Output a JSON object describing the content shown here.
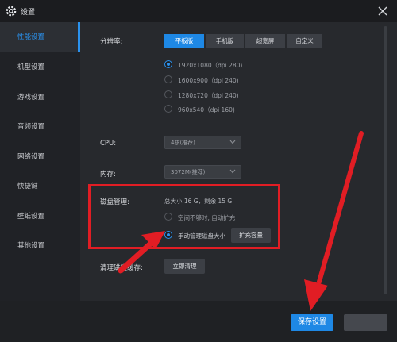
{
  "window": {
    "title": "设置"
  },
  "sidebar": {
    "items": [
      {
        "label": "性能设置",
        "active": true
      },
      {
        "label": "机型设置"
      },
      {
        "label": "游戏设置"
      },
      {
        "label": "音频设置"
      },
      {
        "label": "网络设置"
      },
      {
        "label": "快捷键"
      },
      {
        "label": "壁纸设置"
      },
      {
        "label": "其他设置"
      }
    ]
  },
  "resolution": {
    "label": "分辨率:",
    "tabs": [
      "平板版",
      "手机版",
      "超宽屏",
      "自定义"
    ],
    "active_tab": "平板版",
    "options": [
      "1920x1080（dpi 280)",
      "1600x900（dpi 240)",
      "1280x720（dpi 240)",
      "960x540（dpi 160)"
    ],
    "selected": "1920x1080（dpi 280)"
  },
  "cpu": {
    "label": "CPU:",
    "value": "4核(推荐)"
  },
  "memory": {
    "label": "内存:",
    "value": "3072M(推荐)"
  },
  "disk": {
    "label": "磁盘管理:",
    "info": "总大小 16 G，剩余 15 G",
    "options": [
      "空间不够时, 自动扩充",
      "手动管理磁盘大小"
    ],
    "selected": "手动管理磁盘大小",
    "expand_button": "扩充容量"
  },
  "cache": {
    "label": "清理磁盘缓存:",
    "button": "立即清理"
  },
  "footer": {
    "save_label": "保存设置"
  },
  "colors": {
    "accent": "#1e88e5",
    "annotation": "#e11d24"
  }
}
